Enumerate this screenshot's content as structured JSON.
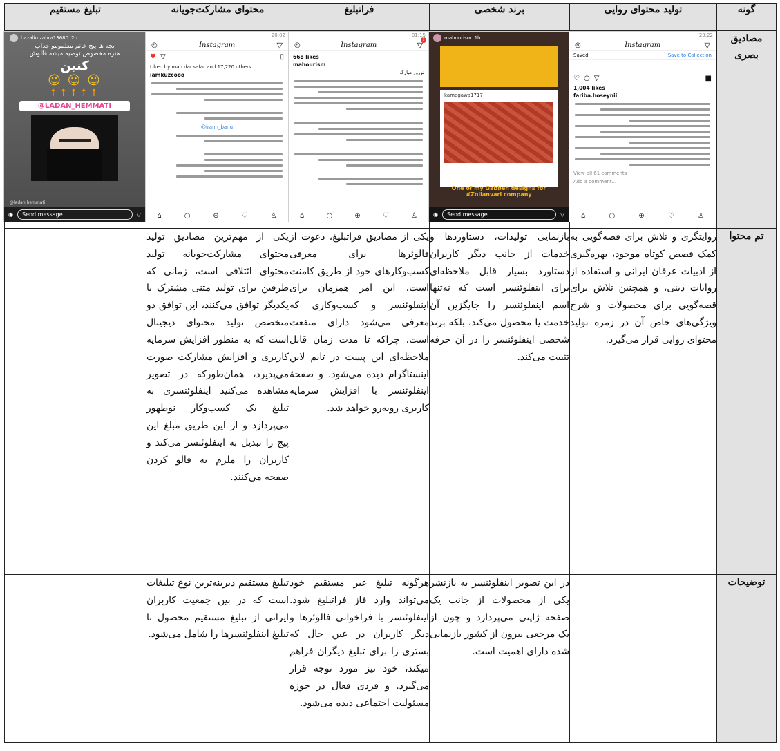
{
  "headers": {
    "type": "گونه",
    "narrative": "تولید محتوای روایی",
    "personal_brand": "برند شخصی",
    "beyond_ad": "فراتبلیغ",
    "participatory": "محتوای مشارکت‌جویانه",
    "direct_ad": "تبلیغ مستقیم"
  },
  "row_labels": {
    "visual": "مصادیق بصری",
    "theme": "تم محتوا",
    "notes": "توضیحات"
  },
  "screenshots": {
    "narrative": {
      "time": "23:22",
      "app": "Instagram",
      "saved": "Saved",
      "save_collection": "Save to Collection",
      "likes": "1,004 likes",
      "user": "fariba.hoseynii",
      "comments": "View all 61 comments",
      "add_comment": "Add a comment..."
    },
    "personal_brand": {
      "user": "mahourism",
      "age": "1h",
      "commenter": "kamegawa1717",
      "caption": "One of my Gabbeh designs for #Zollanvari company",
      "send": "Send message"
    },
    "beyond_ad": {
      "time": "01:15",
      "app": "Instagram",
      "likes": "668 likes",
      "user": "mahourism",
      "greeting": "نوروز مبارک"
    },
    "participatory": {
      "time": "20:02",
      "app": "Instagram",
      "liked_by": "Liked by man.dar.safar and 17,220 others",
      "user": "iamkuzcooo",
      "mention": "@irann_banu"
    },
    "direct_ad": {
      "user": "hazalin.zahra13680",
      "age": "2h",
      "title": "بچه ها پیج خانم معلمومو جذاب",
      "subtitle": "هنره مخصوص توصیه میشه فالوش",
      "big": "کنین",
      "tag": "@LADAN_HEMMATI",
      "handle": "@ladan.hemmati",
      "send": "Send message"
    }
  },
  "theme": {
    "narrative": "روایتگری و تلاش برای قصه‌گویی به کمک قصص کوتاه موجود، بهره‌گیری از ادبیات عرفان ایرانی و استفاده از روایات دینی، و همچنین تلاش برای قصه‌گویی برای محصولات و شرح ویژگی‌های خاص آن در زمره تولید محتوای روایی قرار می‌گیرد.",
    "personal_brand": "بازنمایی تولیدات، دستاوردها و خدمات از جانب دیگر کاربران دستاورد بسیار قابل ملاحظه‌ای برای اینفلوئنسر است که نه‌تنها اسم اینفلوئنسر را جایگزین آن خدمت یا محصول می‌کند، بلکه برند شخصی اینفلوئنسر را در آن حرفه تثبیت می‌کند.",
    "beyond_ad": "یکی از مصادیق فراتبلیغ، دعوت از فالوئرها برای معرفی کسب‌وکارهای خود از طریق کامنت است، این امر همزمان برای اینفلوئنسر و کسب‌وکاری که معرفی می‌شود دارای منفعت است، چراکه تا مدت زمان قابل ملاحظه‌ای این پست در تایم لاین اینستاگرام دیده می‌شود. و صفحهٔ اینفلوئنسر با افزایش سرمایه کاربری روبه‌رو خواهد شد.",
    "participatory": "یکی از مهم‌ترین مصادیق تولید محتوای مشارکت‌جویانه تولید محتوای ائتلافی است، زمانی که طرفین برای تولید متنی مشترک با یکدیگر توافق می‌کنند، این توافق دو متخصص تولید محتوای دیجیتال است که به منظور افزایش سرمایه کاربری و افزایش مشارکت صورت می‌پذیرد، همان‌طورکه در تصویر مشاهده می‌کنید اینفلوئنسری به تبلیغ یک کسب‌وکار نوظهور می‌پردازد و از این طریق مبلغ این پیج را تبدیل به اینفلوئنسر می‌کند و کاربران را ملزم به فالو کردن صفحه می‌کنند.",
    "direct_ad": ""
  },
  "notes": {
    "narrative": "",
    "personal_brand": "در این تصویر اینفلوئنسر به بازنشر یکی از محصولات از جانب یک صفحه ژاپنی می‌پردازد و چون از یک مرجعی بیرون از کشور بازنمایی شده دارای اهمیت است.",
    "beyond_ad": "هرگونه تبلیغ غیر مستقیم خود می‌تواند وارد فاز فراتبلیغ شود. اینفلوئنسر با فراخوانی فالوئرها و دیگر کاربران در عین حال که بستری را برای تبلیغ دیگران فراهم میکند، خود نیز مورد توجه قرار می‌گیرد. و فردی فعال در حوزه مسئولیت اجتماعی دیده می‌شود.",
    "participatory": "تبلیغ مستقیم دیرینه‌ترین نوع تبلیغات است که در بین جمعیت کاربران ایرانی از تبلیغ مستقیم محصول تا تبلیغ اینفلوئنسرها را شامل می‌شود.",
    "direct_ad": ""
  }
}
